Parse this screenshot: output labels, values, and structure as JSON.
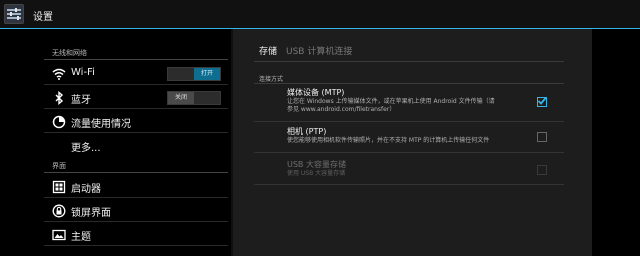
{
  "app": {
    "title": "设置",
    "icon": "settings-icon"
  },
  "sidebar": {
    "section1": "无线和网络",
    "items": [
      {
        "label": "Wi-Fi",
        "icon": "wifi-icon",
        "toggle": "打开",
        "state": "on"
      },
      {
        "label": "蓝牙",
        "icon": "bluetooth-icon",
        "toggle": "关闭",
        "state": "off"
      },
      {
        "label": "流量使用情况",
        "icon": "data-usage-icon"
      },
      {
        "label": "更多..."
      }
    ],
    "section2": "界面",
    "items2": [
      {
        "label": "启动器",
        "icon": "launcher-icon"
      },
      {
        "label": "锁屏界面",
        "icon": "lock-icon"
      },
      {
        "label": "主题",
        "icon": "theme-icon"
      }
    ]
  },
  "main": {
    "tab": "存储",
    "subtab": "USB 计算机连接",
    "section": "连接方式",
    "options": [
      {
        "title": "媒体设备 (MTP)",
        "desc1": "让您在 Windows 上传输媒体文件，或在苹果机上使用 Android 文件传输（请",
        "desc2": "参见 www.android.com/filetransfer）",
        "checked": true,
        "enabled": true
      },
      {
        "title": "相机 (PTP)",
        "desc1": "使您能够使用相机软件传输照片，并在不支持 MTP 的计算机上传输任何文件",
        "checked": false,
        "enabled": true
      },
      {
        "title": "USB 大容量存储",
        "desc1": "使用 USB 大容量存储",
        "checked": false,
        "enabled": false
      }
    ]
  },
  "colors": {
    "accent": "#33b5e5",
    "toggle_on": "#0f6d8f"
  }
}
